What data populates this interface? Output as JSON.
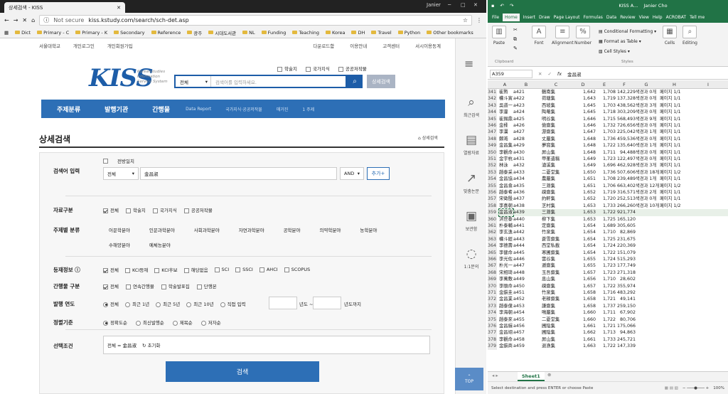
{
  "browser": {
    "tab_title": "상세검색 - KISS",
    "window_user": "Janier",
    "url_prefix": "Not secure",
    "url": "kiss.kstudy.com/search/sch-det.asp"
  },
  "bookmarks": [
    "Dict",
    "Primary - C",
    "Primary - K",
    "Secondary",
    "Reference",
    "광주",
    "시대도서관",
    "NL",
    "Funding",
    "Teaching",
    "Korea",
    "DH",
    "Travel",
    "Python",
    "Other bookmarks"
  ],
  "site": {
    "util_left": [
      "서울대학교",
      "개인로그인",
      "개인회원가입"
    ],
    "util_right": [
      "다운로드함",
      "이용안내",
      "고객센터",
      "서시이용동계"
    ],
    "logo": "KISS",
    "logo_sub": [
      "Koreanstudies",
      "Information",
      "Service System"
    ],
    "top_checks": [
      "학술지",
      "국가지식",
      "공공저작물"
    ],
    "search_scope": "전체",
    "search_placeholder": "검색어를 입력하세요.",
    "detail_btn": "상세검색",
    "nav": {
      "main": [
        "주제분류",
        "발행기관",
        "간행물"
      ],
      "sub": [
        "Data Report",
        "국가지식·공공저작물",
        "매거진",
        "1 주제"
      ]
    },
    "title": "상세검색",
    "crumb": "상세검색",
    "keyword": {
      "label": "검색어 입력",
      "check": "전방일치",
      "scope": "전체",
      "value": "金昌淑",
      "op": "AND",
      "add": "추가+"
    },
    "type": {
      "label": "자료구분",
      "items": [
        "전체",
        "학술지",
        "국가지식",
        "공공저작물"
      ]
    },
    "subject": {
      "label": "주제별 분류",
      "row1": [
        "어문학분야",
        "인문과학분야",
        "사회과학분야",
        "자연과학분야",
        "공학분야",
        "의약학분야",
        "농학분야"
      ],
      "row2": [
        "수해양분야",
        "예체능분야"
      ]
    },
    "reg": {
      "label": "등재정보",
      "items": [
        "전체",
        "KCI등재",
        "KCI후보",
        "해당없음",
        "SCI",
        "SSCI",
        "AHCI",
        "SCOPUS"
      ]
    },
    "pubtype": {
      "label": "간행물 구분",
      "items": [
        "전체",
        "연속간행물",
        "학술발표집",
        "단행본"
      ]
    },
    "year": {
      "label": "발행 연도",
      "items": [
        "전체",
        "최근 1년",
        "최근 5년",
        "최근 10년",
        "직접 입력"
      ],
      "from": "년도 ~",
      "to": "년도까지"
    },
    "sort": {
      "label": "정렬기준",
      "items": [
        "정확도순",
        "최신발행순",
        "제목순",
        "저자순"
      ]
    },
    "cond": {
      "label": "선택조건",
      "value": "전체 = 金昌淑",
      "reset": "초기화"
    },
    "submit": "검색",
    "side": [
      "최근검색",
      "열람자료",
      "맞춤논문",
      "보관함",
      "1:1문의"
    ],
    "top": "TOP"
  },
  "excel": {
    "title": "KISS A...",
    "user": "Janier Cho",
    "tabs": [
      "File",
      "Home",
      "Insert",
      "Draw",
      "Page Layout",
      "Formulas",
      "Data",
      "Review",
      "View",
      "Help",
      "ACROBAT",
      "Tell me"
    ],
    "groups": [
      "Paste",
      "Font",
      "Alignment",
      "Number",
      "Cells",
      "Editing"
    ],
    "styles": [
      "Conditional Formatting",
      "Format as Table",
      "Cell Styles"
    ],
    "group_labels": [
      "Clipboard",
      "Styles"
    ],
    "namebox": "A359",
    "formula": "金昌淑",
    "cols": [
      "A",
      "B",
      "C",
      "D",
      "E",
      "F",
      "G",
      "H",
      "I"
    ],
    "rows": [
      [
        "341",
        "崔㸃",
        "a421",
        "鶴南集",
        "1,642",
        "1,708",
        "142,229",
        "색경과 0개",
        "페이지 1/1"
      ],
      [
        "342",
        "權斗寅",
        "a422",
        "荷塘集",
        "1,643",
        "1,719",
        "137,328",
        "색경과 0개",
        "페이지 1/1"
      ],
      [
        "343",
        "吳道一",
        "a423",
        "西坡集",
        "1,645",
        "1,703",
        "438,562",
        "색경과 3개",
        "페이지 1/1"
      ],
      [
        "344",
        "李瀣",
        "a424",
        "陶菴集",
        "1,645",
        "1,718",
        "303,209",
        "색경과 0개",
        "페이지 1/1"
      ],
      [
        "345",
        "崔錫鼎",
        "a425",
        "明谷集",
        "1,646",
        "1,715",
        "568,493",
        "색경과 9개",
        "페이지 1/1"
      ],
      [
        "346",
        "金楺",
        "a426",
        "儉齋集",
        "1,646",
        "1,732",
        "726,656",
        "색경과 0개",
        "페이지 1/1"
      ],
      [
        "347",
        "李瀷",
        "a427",
        "游齋集",
        "1,647",
        "1,703",
        "225,042",
        "색경과 1개",
        "페이지 1/1"
      ],
      [
        "348",
        "鄭澔",
        "a428",
        "丈巖集",
        "1,648",
        "1,736",
        "459,536",
        "색경과 0개",
        "페이지 1/1"
      ],
      [
        "349",
        "金昌集",
        "a429",
        "夢窩集",
        "1,648",
        "1,722",
        "135,640",
        "색경과 1개",
        "페이지 1/1"
      ],
      [
        "350",
        "李觀命",
        "a430",
        "屛山集",
        "1,648",
        "1,711",
        "94,488",
        "색경과 0개",
        "페이지 1/1"
      ],
      [
        "351",
        "金宇杭",
        "a431",
        "甲峯遺稿",
        "1,649",
        "1,723",
        "122,497",
        "색경과 0개",
        "페이지 1/1"
      ],
      [
        "352",
        "林泳",
        "a432",
        "滄溪集",
        "1,649",
        "1,696",
        "462,928",
        "색경과 3개",
        "페이지 1/1"
      ],
      [
        "353",
        "趙泰采",
        "a433",
        "二憂堂集",
        "1,650",
        "1,736",
        "507,606",
        "색경과 18개",
        "페이지 1/2"
      ],
      [
        "354",
        "金昌協",
        "a434",
        "農巖集",
        "1,651",
        "1,708",
        "239,489",
        "색경과 1개",
        "페이지 1/1"
      ],
      [
        "355",
        "金昌翕",
        "a435",
        "三淵集",
        "1,651",
        "1,706",
        "663,402",
        "색경과 12개",
        "페이지 1/2"
      ],
      [
        "356",
        "趙泰耉",
        "a436",
        "疎齋集",
        "1,652",
        "1,719",
        "316,571",
        "색경과 2개",
        "페이지 1/1"
      ],
      [
        "357",
        "宋徵殷",
        "a437",
        "約軒集",
        "1,652",
        "1,720",
        "252,513",
        "색경과 0개",
        "페이지 1/1"
      ],
      [
        "358",
        "李喜朝",
        "a438",
        "芝村集",
        "1,653",
        "1,733",
        "266,260",
        "색경과 10개",
        "페이지 1/2"
      ],
      [
        "359",
        "金昌淑",
        "a439",
        "三淵集",
        "1,653",
        "1,722",
        "921,774",
        "",
        ""
      ],
      [
        "360",
        "洪世泰",
        "a440",
        "柳下集",
        "1,653",
        "1,725",
        "165,120",
        "",
        ""
      ],
      [
        "361",
        "朴泰輔",
        "a441",
        "定齋集",
        "1,654",
        "1,689",
        "305,605",
        "",
        ""
      ],
      [
        "362",
        "李玄逸",
        "a442",
        "竹泉集",
        "1,654",
        "1,710",
        "82,869",
        "",
        ""
      ],
      [
        "363",
        "權斗經",
        "a443",
        "蒼雪齋集",
        "1,654",
        "1,725",
        "231,675",
        "",
        ""
      ],
      [
        "364",
        "李德壽",
        "a444",
        "西堂私載",
        "1,654",
        "1,724",
        "220,369",
        "",
        ""
      ],
      [
        "365",
        "李健命",
        "a445",
        "寒圃齋集",
        "1,654",
        "1,722",
        "151,079",
        "",
        ""
      ],
      [
        "366",
        "李光佐",
        "a446",
        "雲谷集",
        "1,655",
        "1,724",
        "515,293",
        "",
        ""
      ],
      [
        "367",
        "朴光一",
        "a447",
        "遜齋集",
        "1,655",
        "1,723",
        "177,749",
        "",
        ""
      ],
      [
        "368",
        "宋相琦",
        "a448",
        "玉吾齋集",
        "1,657",
        "1,723",
        "271,318",
        "",
        ""
      ],
      [
        "369",
        "李萬敷",
        "a449",
        "息山集",
        "1,656",
        "1,710",
        "28,602",
        "",
        ""
      ],
      [
        "370",
        "李頤命",
        "a450",
        "疎齋集",
        "1,657",
        "1,722",
        "355,974",
        "",
        ""
      ],
      [
        "371",
        "金鎭圭",
        "a451",
        "竹泉集",
        "1,658",
        "1,716",
        "483,292",
        "",
        ""
      ],
      [
        "372",
        "金昌業",
        "a452",
        "老稼齋集",
        "1,658",
        "1,721",
        "49,141",
        "",
        ""
      ],
      [
        "373",
        "趙泰億",
        "a453",
        "謙齋集",
        "1,658",
        "1,737",
        "259,150",
        "",
        ""
      ],
      [
        "374",
        "李海朝",
        "a454",
        "鳴巖集",
        "1,660",
        "1,711",
        "67,902",
        "",
        ""
      ],
      [
        "375",
        "趙泰來",
        "a455",
        "二憂堂集",
        "1,660",
        "1,722",
        "80,706",
        "",
        ""
      ],
      [
        "376",
        "金昌緝",
        "a456",
        "圃陰集",
        "1,661",
        "1,721",
        "175,066",
        "",
        ""
      ],
      [
        "377",
        "金昌翊",
        "a457",
        "圃陰集",
        "1,662",
        "1,713",
        "94,863",
        "",
        ""
      ],
      [
        "378",
        "李觀命",
        "a458",
        "屛山集",
        "1,661",
        "1,733",
        "245,721",
        "",
        ""
      ],
      [
        "379",
        "金鎭商",
        "a459",
        "退漁集",
        "1,663",
        "1,722",
        "147,339",
        "",
        ""
      ]
    ],
    "sheet": "Sheet1",
    "status": "Select destination and press ENTER or choose Paste",
    "zoom": "100%"
  }
}
